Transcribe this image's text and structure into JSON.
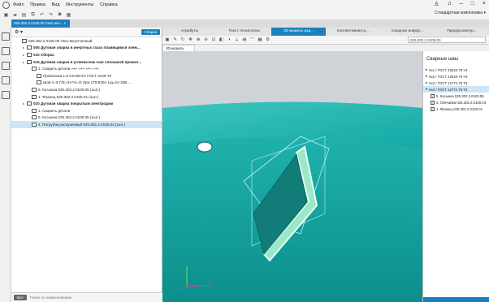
{
  "app": {
    "menu": [
      "Файл",
      "Правка",
      "Вид",
      "Инструменты",
      "Справка"
    ],
    "config_select": "Стандартная компоновка"
  },
  "doc_tab": "025.302.2.0100.00 Узел вкл...",
  "tree": {
    "header_button": "Сборка",
    "rows": [
      {
        "text": "025.302.2.0100.00 Узел вкпучченный",
        "indent": 1,
        "bold": false,
        "sel": false
      },
      {
        "text": "005 Дуговая сварка в инертных газах плавящимся элем...",
        "indent": 2,
        "bold": true,
        "sel": false
      },
      {
        "text": "010 Сборка",
        "indent": 2,
        "bold": true,
        "sel": false
      },
      {
        "text": "015 Дуговая сварка в углекислом газе сплошной провол...",
        "indent": 2,
        "bold": true,
        "sel": false
      },
      {
        "text": "1. Сварить детали ‹‹•›› ‹‹•›› ‹‹•›› ‹‹•››",
        "indent": 3,
        "bold": false,
        "sel": false
      },
      {
        "text": "Проволока 1,6 Св-08Г2С ГОСТ 2246-70",
        "indent": 4,
        "bold": false,
        "sel": false
      },
      {
        "text": "Шов-1:-6 Г/Е=/Н Пл=О Луж 170-830А Uд=21-32В ...",
        "indent": 4,
        "bold": false,
        "sel": false
      },
      {
        "text": "5. Косынка 025.302.2.0100.05 (1шт.)",
        "indent": 3,
        "bold": false,
        "sel": false
      },
      {
        "text": "1. Фланец 025.302.2.0100.01 (1шт.)",
        "indent": 3,
        "bold": false,
        "sel": false
      },
      {
        "text": "020 Дуговая сварка покрытым электродом",
        "indent": 2,
        "bold": true,
        "sel": false
      },
      {
        "text": "1. Сварить детали",
        "indent": 3,
        "bold": false,
        "sel": false
      },
      {
        "text": "5. Косынка 025.302.2.0100.05 (1шт.)",
        "indent": 3,
        "bold": false,
        "sel": false
      },
      {
        "text": "4. Патрубок распузенный 025.302.2.0100.04 (1шт.)",
        "indent": 3,
        "bold": false,
        "sel": true
      }
    ],
    "search_all": "Все",
    "search_placeholder": "Поиск по наименованию"
  },
  "main_tabs": [
    "Атрибуты",
    "Текст технологии",
    "3D-модель изд...",
    "Коллективная р...",
    "Сводная инфор...",
    "Предпросмотр..."
  ],
  "search_value": "025.302.2.0100.00",
  "model_tab": "3D-модель",
  "welds": {
    "title": "Сварные швы",
    "rows": [
      {
        "text": "№1 / ГОСТ 23518-79 У3",
        "type": "group",
        "sel": false
      },
      {
        "text": "№2 / ГОСТ 23518-79 У3",
        "type": "group",
        "sel": false
      },
      {
        "text": "№3 / ГОСТ 14771-76 Т3",
        "type": "group",
        "sel": false
      },
      {
        "text": "№4 / ГОСТ 14771-76 Т3",
        "type": "group",
        "sel": true
      },
      {
        "text": "5. Косынка 025.302.2.0100.05",
        "type": "item",
        "sel": false
      },
      {
        "text": "3. Обечайка 025.302.2.0100.03",
        "type": "item",
        "sel": false
      },
      {
        "text": "1. Фланец 025.302.2.0100.01",
        "type": "item",
        "sel": false
      }
    ]
  }
}
